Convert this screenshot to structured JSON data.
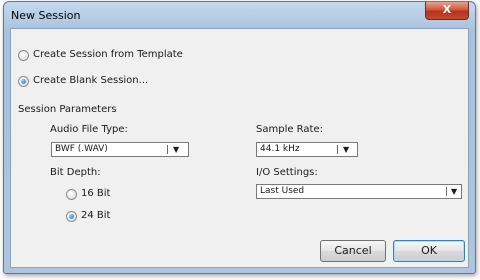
{
  "window": {
    "title": "New Session",
    "close_label": "X"
  },
  "options": {
    "from_template_label": "Create Session from Template",
    "blank_label": "Create Blank Session...",
    "selected": "blank"
  },
  "params": {
    "section_label": "Session Parameters",
    "audio_file_type": {
      "label": "Audio File Type:",
      "value": "BWF (.WAV)"
    },
    "sample_rate": {
      "label": "Sample Rate:",
      "value": "44.1 kHz"
    },
    "bit_depth": {
      "label": "Bit Depth:",
      "options": [
        "16 Bit",
        "24 Bit"
      ],
      "selected": "24 Bit"
    },
    "io_settings": {
      "label": "I/O Settings:",
      "value": "Last Used"
    }
  },
  "buttons": {
    "cancel": "Cancel",
    "ok": "OK"
  }
}
